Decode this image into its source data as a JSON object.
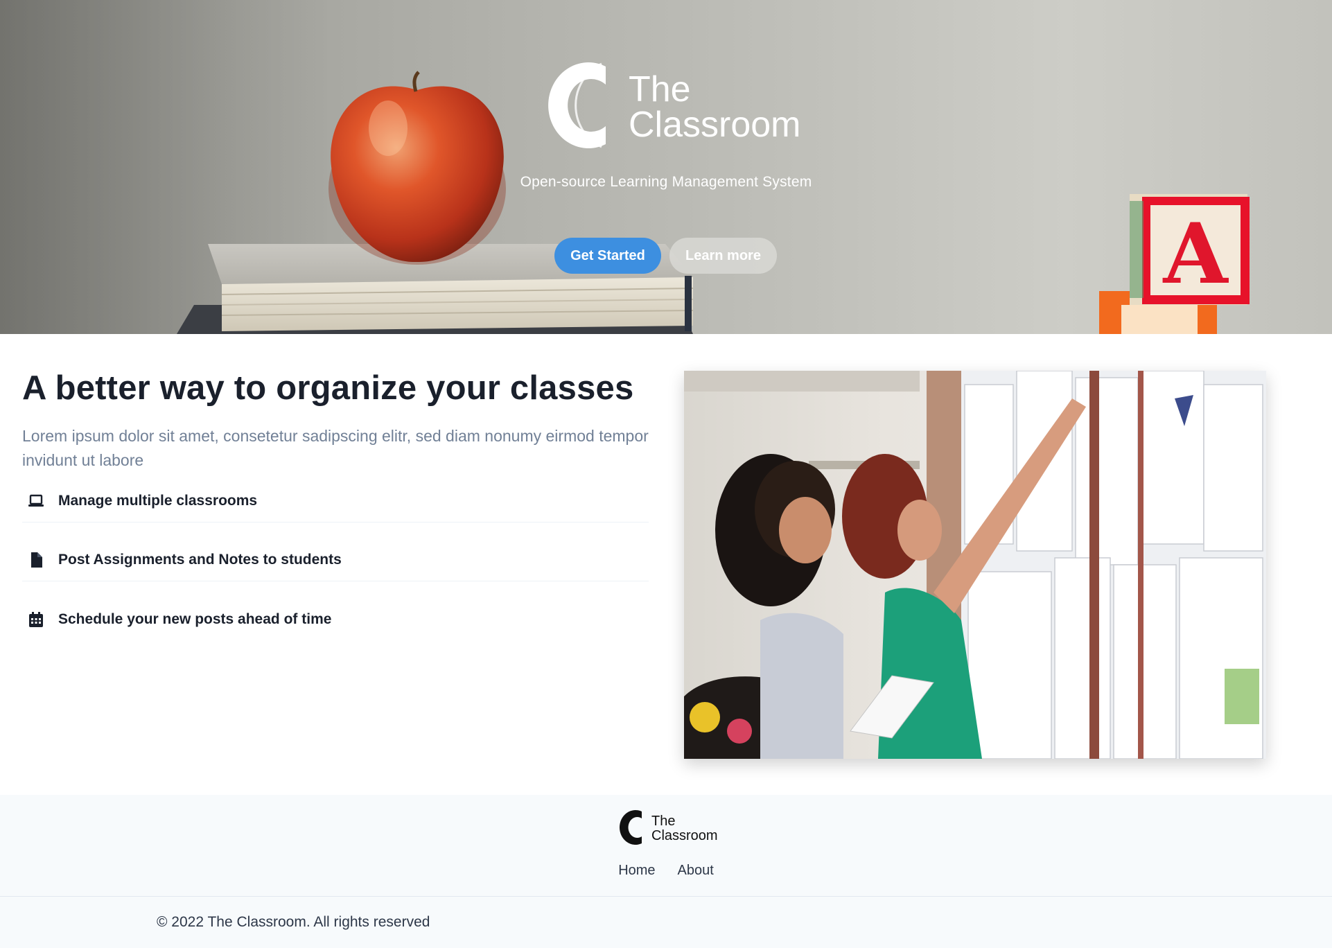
{
  "hero": {
    "logo_line1": "The",
    "logo_line2": "Classroom",
    "subtitle": "Open-source Learning Management System",
    "primary_button": "Get Started",
    "secondary_button": "Learn more",
    "block_letter": "A"
  },
  "features": {
    "title": "A better way to organize your classes",
    "description": "Lorem ipsum dolor sit amet, consetetur sadipscing elitr, sed diam nonumy eirmod tempor invidunt ut labore",
    "items": [
      {
        "icon": "laptop-icon",
        "label": "Manage multiple classrooms"
      },
      {
        "icon": "file-icon",
        "label": "Post Assignments and Notes to students"
      },
      {
        "icon": "calendar-icon",
        "label": "Schedule your new posts ahead of time"
      }
    ]
  },
  "footer": {
    "logo_line1": "The",
    "logo_line2": "Classroom",
    "nav": [
      "Home",
      "About"
    ],
    "copyright": "© 2022 The Classroom. All rights reserved"
  },
  "colors": {
    "accent": "#3d8fe0",
    "heading": "#1a202c",
    "muted": "#718096",
    "footer_bg": "#f7fafc"
  }
}
